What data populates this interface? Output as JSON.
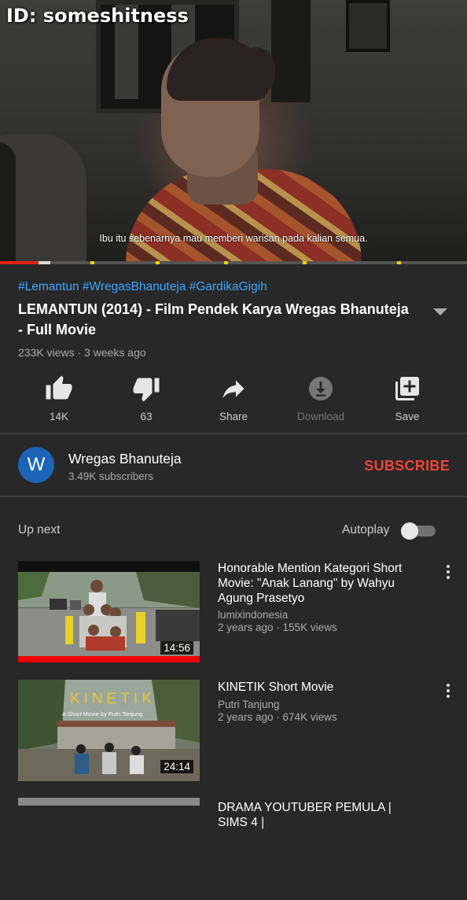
{
  "player": {
    "watermark": "ID: someshitness",
    "subtitle": "Ibu itu sebenarnya mau memberi warisan pada kalian semua.",
    "progress_played_fraction": 0.083
  },
  "video": {
    "hashtags": "#Lemantun #WregasBhanuteja #GardikaGigih",
    "title": "LEMANTUN (2014) - Film Pendek Karya Wregas Bhanuteja - Full Movie",
    "meta": "233K views · 3 weeks ago"
  },
  "actions": {
    "like": "14K",
    "dislike": "63",
    "share": "Share",
    "download": "Download",
    "save": "Save"
  },
  "channel": {
    "avatar_letter": "W",
    "name": "Wregas Bhanuteja",
    "subscribers": "3.49K subscribers",
    "subscribe_label": "SUBSCRIBE"
  },
  "upnext": {
    "label": "Up next",
    "autoplay_label": "Autoplay",
    "autoplay_on": false
  },
  "videos": [
    {
      "title": "Honorable Mention Kategori Short Movie: \"Anak Lanang\" by Wahyu Agung Prasetyo",
      "channel": "lumixindonesia",
      "meta": "2 years ago · 155K views",
      "duration": "14:56"
    },
    {
      "title": "KINETIK Short Movie",
      "channel": "Putri Tanjung",
      "meta": "2 years ago · 674K views",
      "duration": "24:14",
      "thumb_title": "KINETIK",
      "thumb_subtitle": "A Short Movie by Putri Tanjung"
    },
    {
      "title": "DRAMA YOUTUBER PEMULA | SIMS 4 |"
    }
  ],
  "colors": {
    "background": "#282828",
    "accent_red": "#f0433a",
    "link_blue": "#3ea6ff",
    "avatar_blue": "#1c64b8"
  }
}
